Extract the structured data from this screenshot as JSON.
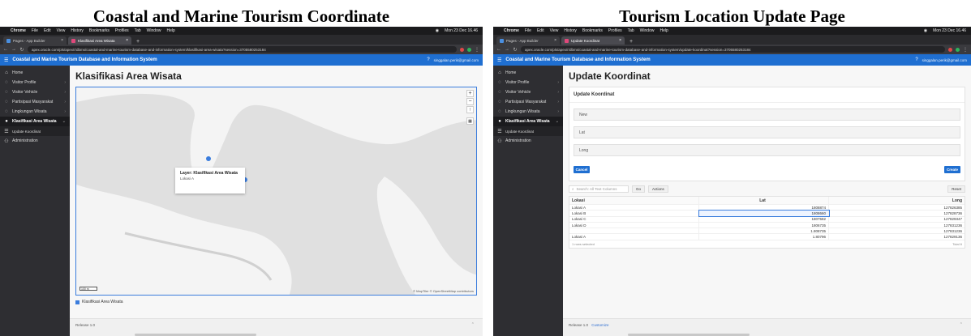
{
  "captions": {
    "left": "Coastal and Marine Tourism Coordinate",
    "right": "Tourism Location Update Page"
  },
  "menubar": {
    "app": "Chrome",
    "items": [
      "File",
      "Edit",
      "View",
      "History",
      "Bookmarks",
      "Profiles",
      "Tab",
      "Window",
      "Help"
    ],
    "clock": "Mon 23 Dec 16.46"
  },
  "browser_left": {
    "tabs": [
      "Pages - App Builder",
      "Klasifikasi Area Wisata"
    ],
    "url": "apex.oracle.com/pls/apex/r/dbms/coastal-and-marine-tourism-database-and-information-system/klasifikasi-area-wisata?session=3705580253184"
  },
  "browser_right": {
    "tabs": [
      "Pages - App Builder",
      "Update Koordinat"
    ],
    "url": "apex.oracle.com/pls/apex/r/dbms/coastal-and-marine-tourism-database-and-information-system/update-koordinat?session=3705580253184"
  },
  "app": {
    "title": "Coastal and Marine Tourism Database and Information System",
    "user": "singgalan.perik@gmail.com"
  },
  "nav": {
    "home": "Home",
    "visitor_profile": "Visitor Profile",
    "visitor_vehicle": "Visitor Vehicle",
    "partisipasi": "Partisipasi Masyarakat",
    "lingkungan": "Lingkungan Wisata",
    "klasifikasi": "Klasifikasi Area Wisata",
    "update_koordinat": "Update Koordinat",
    "administration": "Administration"
  },
  "left_page": {
    "title": "Klasifikasi Area Wisata",
    "popup_title": "Layer: Klasifikasi Area Wisata",
    "popup_sub": "Lokasi A",
    "scale": "100 m",
    "attribution": "© MapTiler © OpenStreetMap contributors",
    "legend": "Klasifikasi Area Wisata",
    "footer": "Release 1.0"
  },
  "right_page": {
    "title": "Update Koordinat",
    "card_title": "Update Koordinat",
    "fields": [
      "New",
      "Lat",
      "Long"
    ],
    "cancel": "Cancel",
    "create": "Create",
    "search_placeholder": "Search: All Text Columns",
    "go": "Go",
    "actions": "Actions",
    "reset": "Reset",
    "columns": [
      "Lokasi",
      "Lat",
      "Long"
    ],
    "rows": [
      [
        "Lokasi A",
        "1808874",
        "127826385"
      ],
      [
        "Lokasi B",
        "1808660",
        "127828736"
      ],
      [
        "Lokasi C",
        "1807582",
        "127829347"
      ],
      [
        "Lokasi D",
        "1806735",
        "127831236"
      ],
      [
        "",
        "1.808735",
        "127831236"
      ],
      [
        "Lokasi A",
        "1.80796",
        "127829136"
      ]
    ],
    "rows_selected": "1 rows selected",
    "total": "Total 6",
    "footer": "Release 1.0",
    "footer_link": "Customize"
  }
}
